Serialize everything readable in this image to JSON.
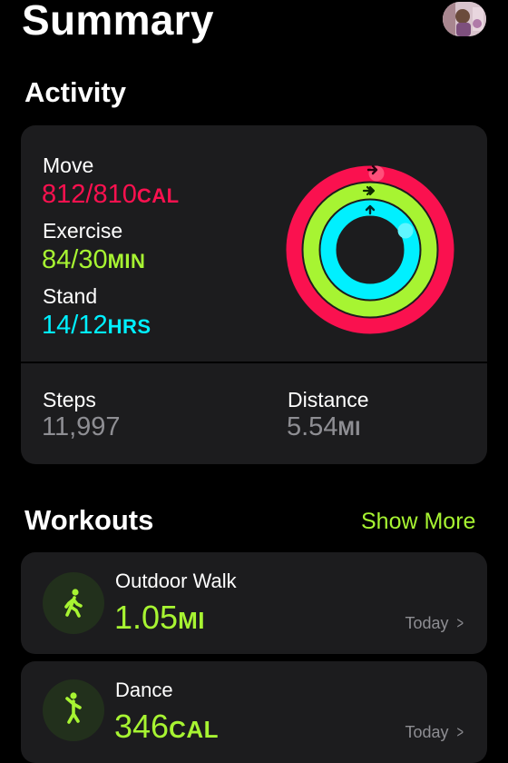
{
  "header": {
    "title": "Summary"
  },
  "activity": {
    "heading": "Activity",
    "rings": [
      {
        "label": "Move",
        "value": "812/810",
        "unit": "CAL",
        "color": "#fa114f",
        "progress": 1.0025
      },
      {
        "label": "Exercise",
        "value": "84/30",
        "unit": "MIN",
        "color": "#a7f432",
        "progress": 2.8
      },
      {
        "label": "Stand",
        "value": "14/12",
        "unit": "HRS",
        "color": "#00f0ff",
        "progress": 1.1667
      }
    ],
    "steps": {
      "label": "Steps",
      "value": "11,997"
    },
    "distance": {
      "label": "Distance",
      "value": "5.54",
      "unit": "MI"
    }
  },
  "workouts": {
    "heading": "Workouts",
    "show_more": "Show More",
    "items": [
      {
        "name": "Outdoor Walk",
        "value": "1.05",
        "unit": "MI",
        "date": "Today",
        "icon": "walking-figure-icon"
      },
      {
        "name": "Dance",
        "value": "346",
        "unit": "CAL",
        "date": "Today",
        "icon": "dancing-figure-icon"
      }
    ]
  },
  "colors": {
    "background": "#000000",
    "card": "#1c1c1e",
    "move": "#fa114f",
    "exercise": "#a7f432",
    "stand": "#00f0ff",
    "secondary_text": "#8e8e93"
  }
}
